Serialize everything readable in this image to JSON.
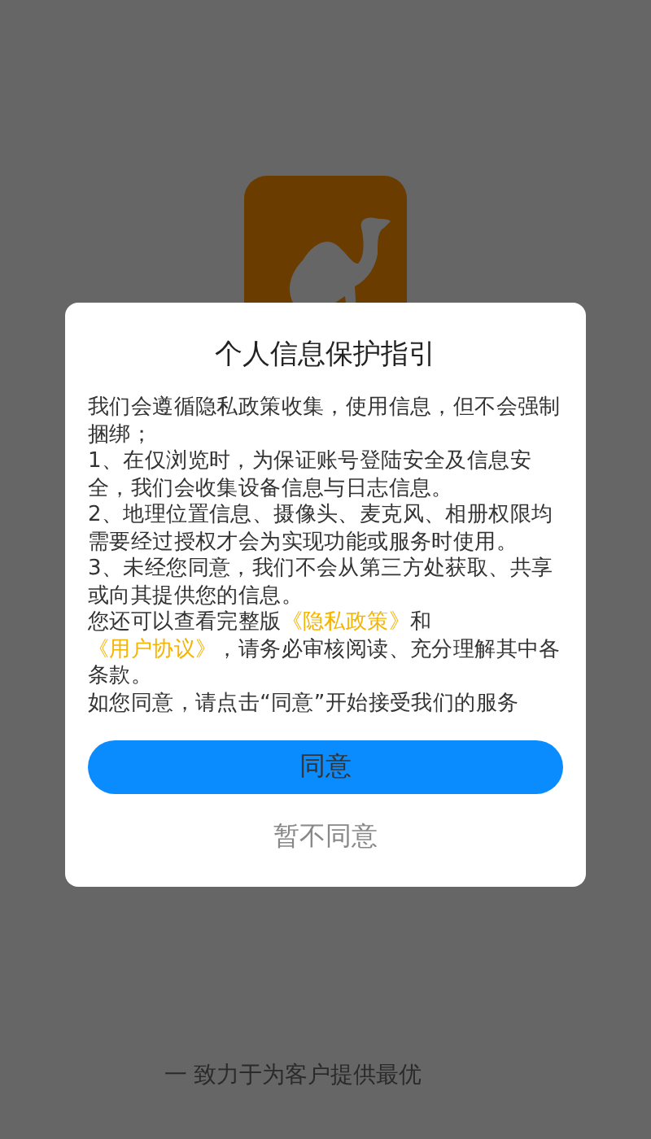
{
  "app": {
    "slogan": "一 致力于为客户提供最优"
  },
  "dialog": {
    "title": "个人信息保护指引",
    "paragraphs": [
      [
        {
          "kind": "text",
          "text": "我们会遵循隐私政策收集，使用信息，但不会强制捆绑；"
        }
      ],
      [
        {
          "kind": "text",
          "text": "1、在仅浏览时，为保证账号登陆安全及信息安全，我们会收集设备信息与日志信息。"
        }
      ],
      [
        {
          "kind": "text",
          "text": "2、地理位置信息、摄像头、麦克风、相册权限均需要经过授权才会为实现功能或服务时使用。"
        }
      ],
      [
        {
          "kind": "text",
          "text": "3、未经您同意，我们不会从第三方处获取、共享或向其提供您的信息。"
        }
      ],
      [
        {
          "kind": "text",
          "text": "您还可以查看完整版"
        },
        {
          "kind": "link",
          "text": "《隐私政策》"
        },
        {
          "kind": "text",
          "text": "和"
        },
        {
          "kind": "link",
          "text": "《用户协议》"
        },
        {
          "kind": "text",
          "text": "，请务必审核阅读、充分理解其中各条款。"
        }
      ],
      [
        {
          "kind": "text",
          "text": "如您同意，请点击“同意”开始接受我们的服务"
        }
      ]
    ],
    "agree_button": "同意",
    "decline_button": "暂不同意"
  }
}
